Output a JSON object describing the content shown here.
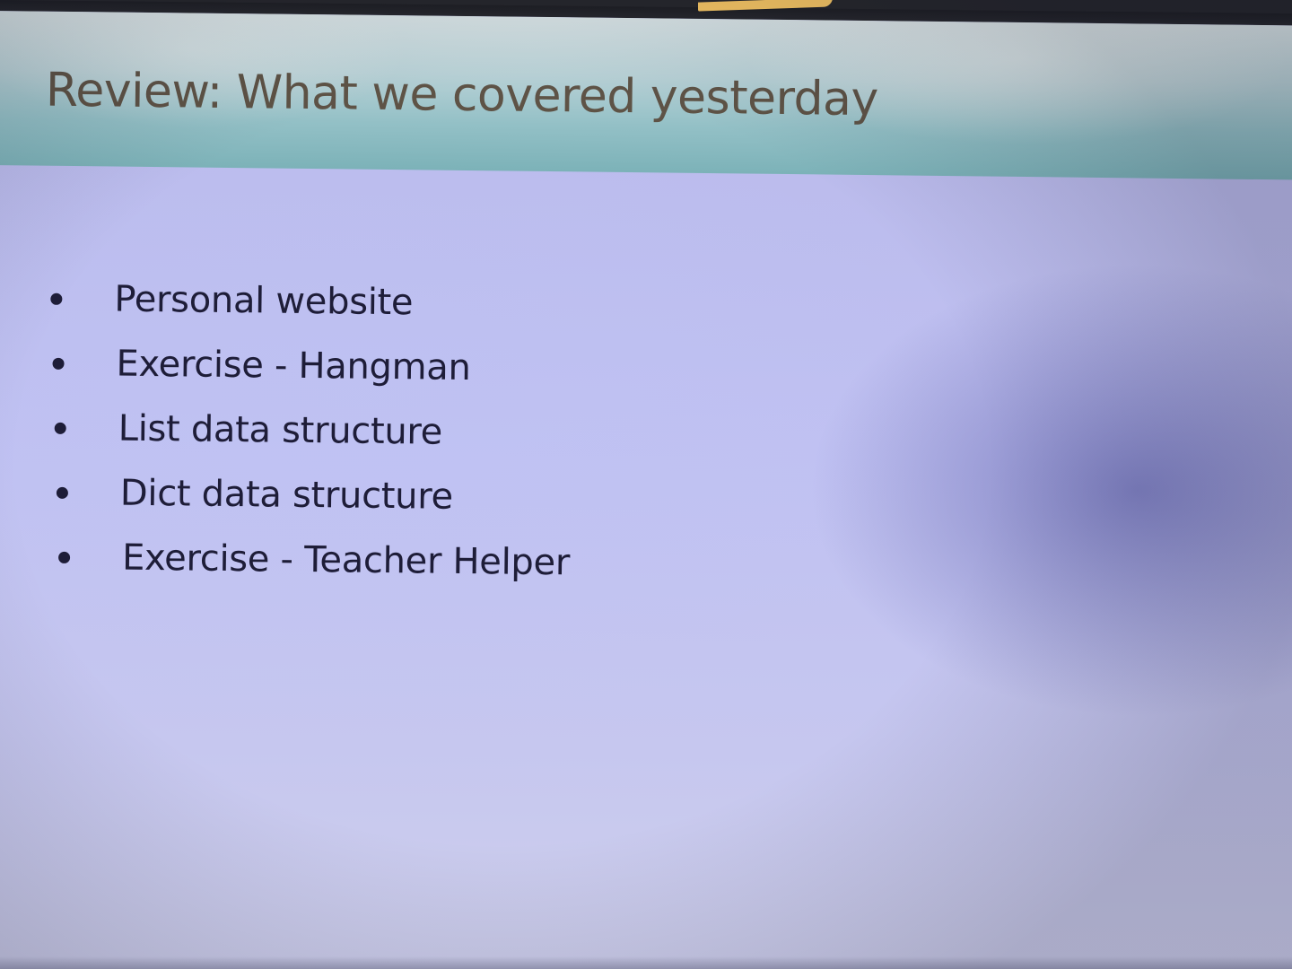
{
  "slide": {
    "title": "Review: What we covered yesterday",
    "bullets": [
      "Personal website",
      "Exercise - Hangman",
      "List data structure",
      "Dict data structure",
      "Exercise - Teacher Helper"
    ]
  },
  "colors": {
    "title_text": "#5e5346",
    "body_text": "#1e1d38",
    "title_band": "#93c0c6",
    "slide_background": "#c0c1f2",
    "sticky_note": "#f4c463"
  }
}
